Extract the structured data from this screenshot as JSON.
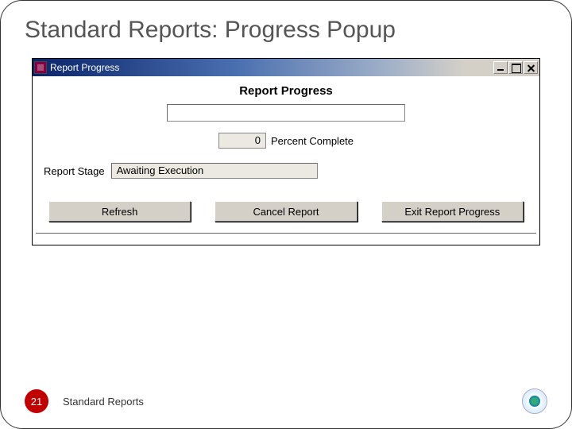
{
  "slide": {
    "title": "Standard Reports: Progress Popup",
    "page_number": "21",
    "footer": "Standard Reports"
  },
  "window": {
    "title": "Report Progress",
    "header": "Report Progress",
    "percent_value": "0",
    "percent_label": "Percent Complete",
    "stage_label": "Report Stage",
    "stage_value": "Awaiting Execution",
    "buttons": {
      "refresh": "Refresh",
      "cancel": "Cancel Report",
      "exit": "Exit Report Progress"
    }
  }
}
